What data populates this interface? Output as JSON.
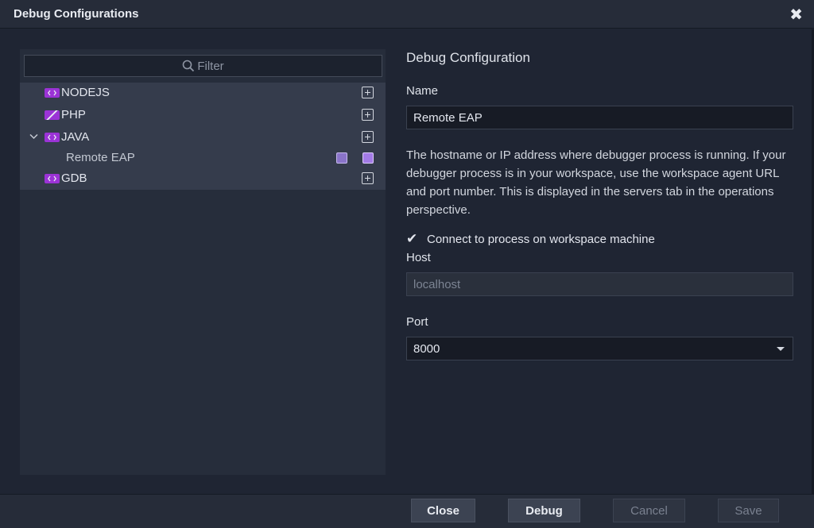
{
  "window": {
    "title": "Debug Configurations",
    "close_symbol": "✖"
  },
  "filter": {
    "placeholder": "Filter",
    "icon": "search-icon"
  },
  "tree": {
    "items": [
      {
        "label": "NODEJS",
        "icon": "code-icon",
        "expanded": false
      },
      {
        "label": "PHP",
        "icon": "php-icon",
        "expanded": false
      },
      {
        "label": "JAVA",
        "icon": "code-icon",
        "expanded": true,
        "children": [
          {
            "label": "Remote EAP"
          }
        ]
      },
      {
        "label": "GDB",
        "icon": "code-icon",
        "expanded": false
      }
    ]
  },
  "config": {
    "section_title": "Debug Configuration",
    "name_label": "Name",
    "name_value": "Remote EAP",
    "description": "The hostname or IP address where debugger process is running. If your debugger process is in your workspace, use the workspace agent URL and port number. This is displayed in the servers tab in the operations perspective.",
    "checkbox_label": "Connect to process on workspace machine",
    "checkbox_checked": true,
    "check_symbol": "✔",
    "host_label": "Host",
    "host_value": "localhost",
    "port_label": "Port",
    "port_value": "8000"
  },
  "footer": {
    "close_label": "Close",
    "debug_label": "Debug",
    "cancel_label": "Cancel",
    "save_label": "Save"
  },
  "colors": {
    "accent": "#9b33d6",
    "background": "#1f2533",
    "panel": "#262d3b"
  }
}
